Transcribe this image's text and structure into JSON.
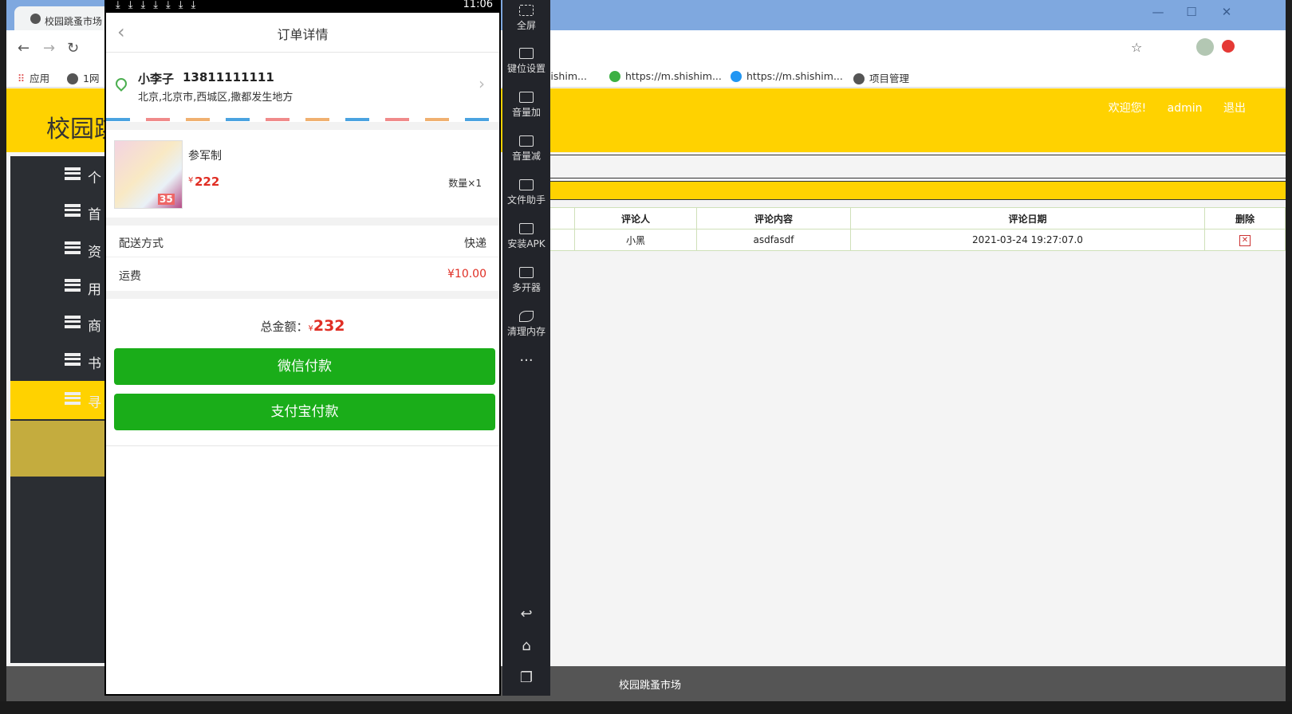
{
  "browser": {
    "tab_title": "校园跳蚤市场",
    "bookmarks": [
      "应用",
      "1网",
      "shishim...",
      "https://m.shishim...",
      "https://m.shishim...",
      "项目管理"
    ]
  },
  "site": {
    "logo": "校园跳",
    "welcome": "欢迎您!",
    "user": "admin",
    "logout": "退出",
    "footer": "校园跳蚤市场",
    "sidebar": [
      "个",
      "首",
      "资",
      "用",
      "商",
      "书",
      "寻"
    ],
    "table": {
      "headers": [
        "评论人",
        "评论内容",
        "评论日期",
        "删除"
      ],
      "rows": [
        {
          "commenter": "小黑",
          "content": "asdfasdf",
          "date": "2021-03-24 19:27:07.0"
        }
      ]
    }
  },
  "phone": {
    "time": "11:06",
    "title": "订单详情",
    "name": "小李子",
    "phone_no": "13811111111",
    "address": "北京,北京市,西城区,撒都发生地方",
    "product_name": "参军制",
    "currency": "¥",
    "price": "222",
    "quantity": "数量×1",
    "thumb_tag": "35",
    "delivery_label": "配送方式",
    "delivery_value": "快递",
    "freight_label": "运费",
    "freight_value": "¥10.00",
    "total_label": "总金额：",
    "total_value": "232",
    "wechat_pay": "微信付款",
    "alipay": "支付宝付款"
  },
  "emulator_tools": [
    "全屏",
    "键位设置",
    "音量加",
    "音量减",
    "文件助手",
    "安装APK",
    "多开器",
    "清理内存"
  ],
  "colors": {
    "accent_yellow": "#ffd200",
    "pay_green": "#1aad19",
    "price_red": "#e02e24"
  }
}
